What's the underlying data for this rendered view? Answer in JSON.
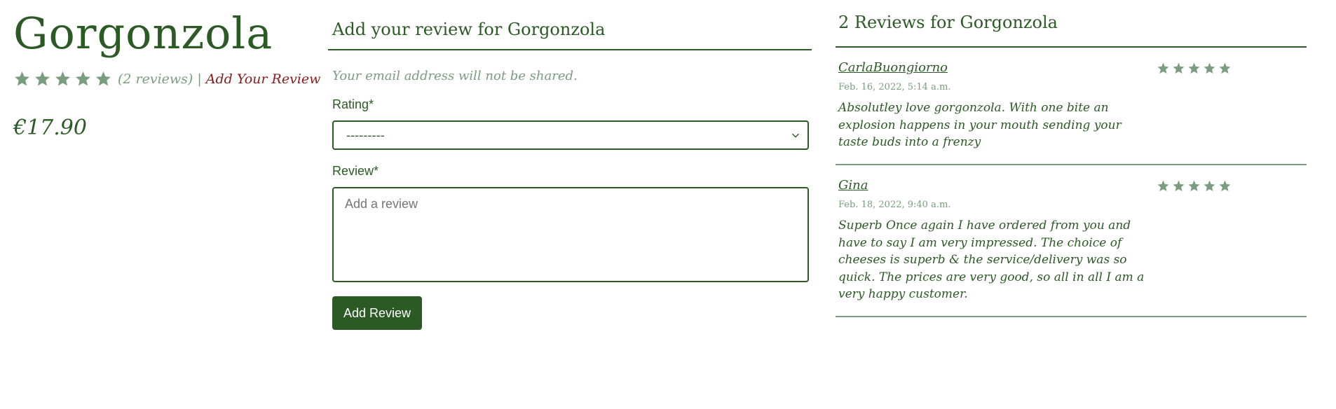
{
  "product": {
    "name": "Gorgonzola",
    "rating_stars": 5,
    "review_count_text": "(2 reviews)",
    "separator": "|",
    "add_review_link": "Add Your Review",
    "price": "€17.90"
  },
  "form": {
    "title": "Add your review for Gorgonzola",
    "note": "Your email address will not be shared.",
    "rating_label": "Rating*",
    "rating_selected": "---------",
    "review_label": "Review*",
    "review_placeholder": "Add a review",
    "submit_label": "Add Review"
  },
  "reviews": {
    "title": "2 Reviews for Gorgonzola",
    "items": [
      {
        "author": "CarlaBuongiorno",
        "date": "Feb. 16, 2022, 5:14 a.m.",
        "text": "Absolutley love gorgonzola. With one bite an explosion happens in your mouth sending your taste buds into a frenzy",
        "stars": 5
      },
      {
        "author": "Gina",
        "date": "Feb. 18, 2022, 9:40 a.m.",
        "text": "Superb Once again I have ordered from you and have to say I am very impressed. The choice of cheeses is superb & the service/delivery was so quick. The prices are very good, so all in all I am a very happy customer.",
        "stars": 5
      }
    ]
  },
  "colors": {
    "primary": "#2b5a25",
    "muted": "#7a9c7f",
    "link": "#8b1a1a"
  },
  "icons": {
    "star": "star-icon",
    "chevron": "chevron-down-icon"
  }
}
